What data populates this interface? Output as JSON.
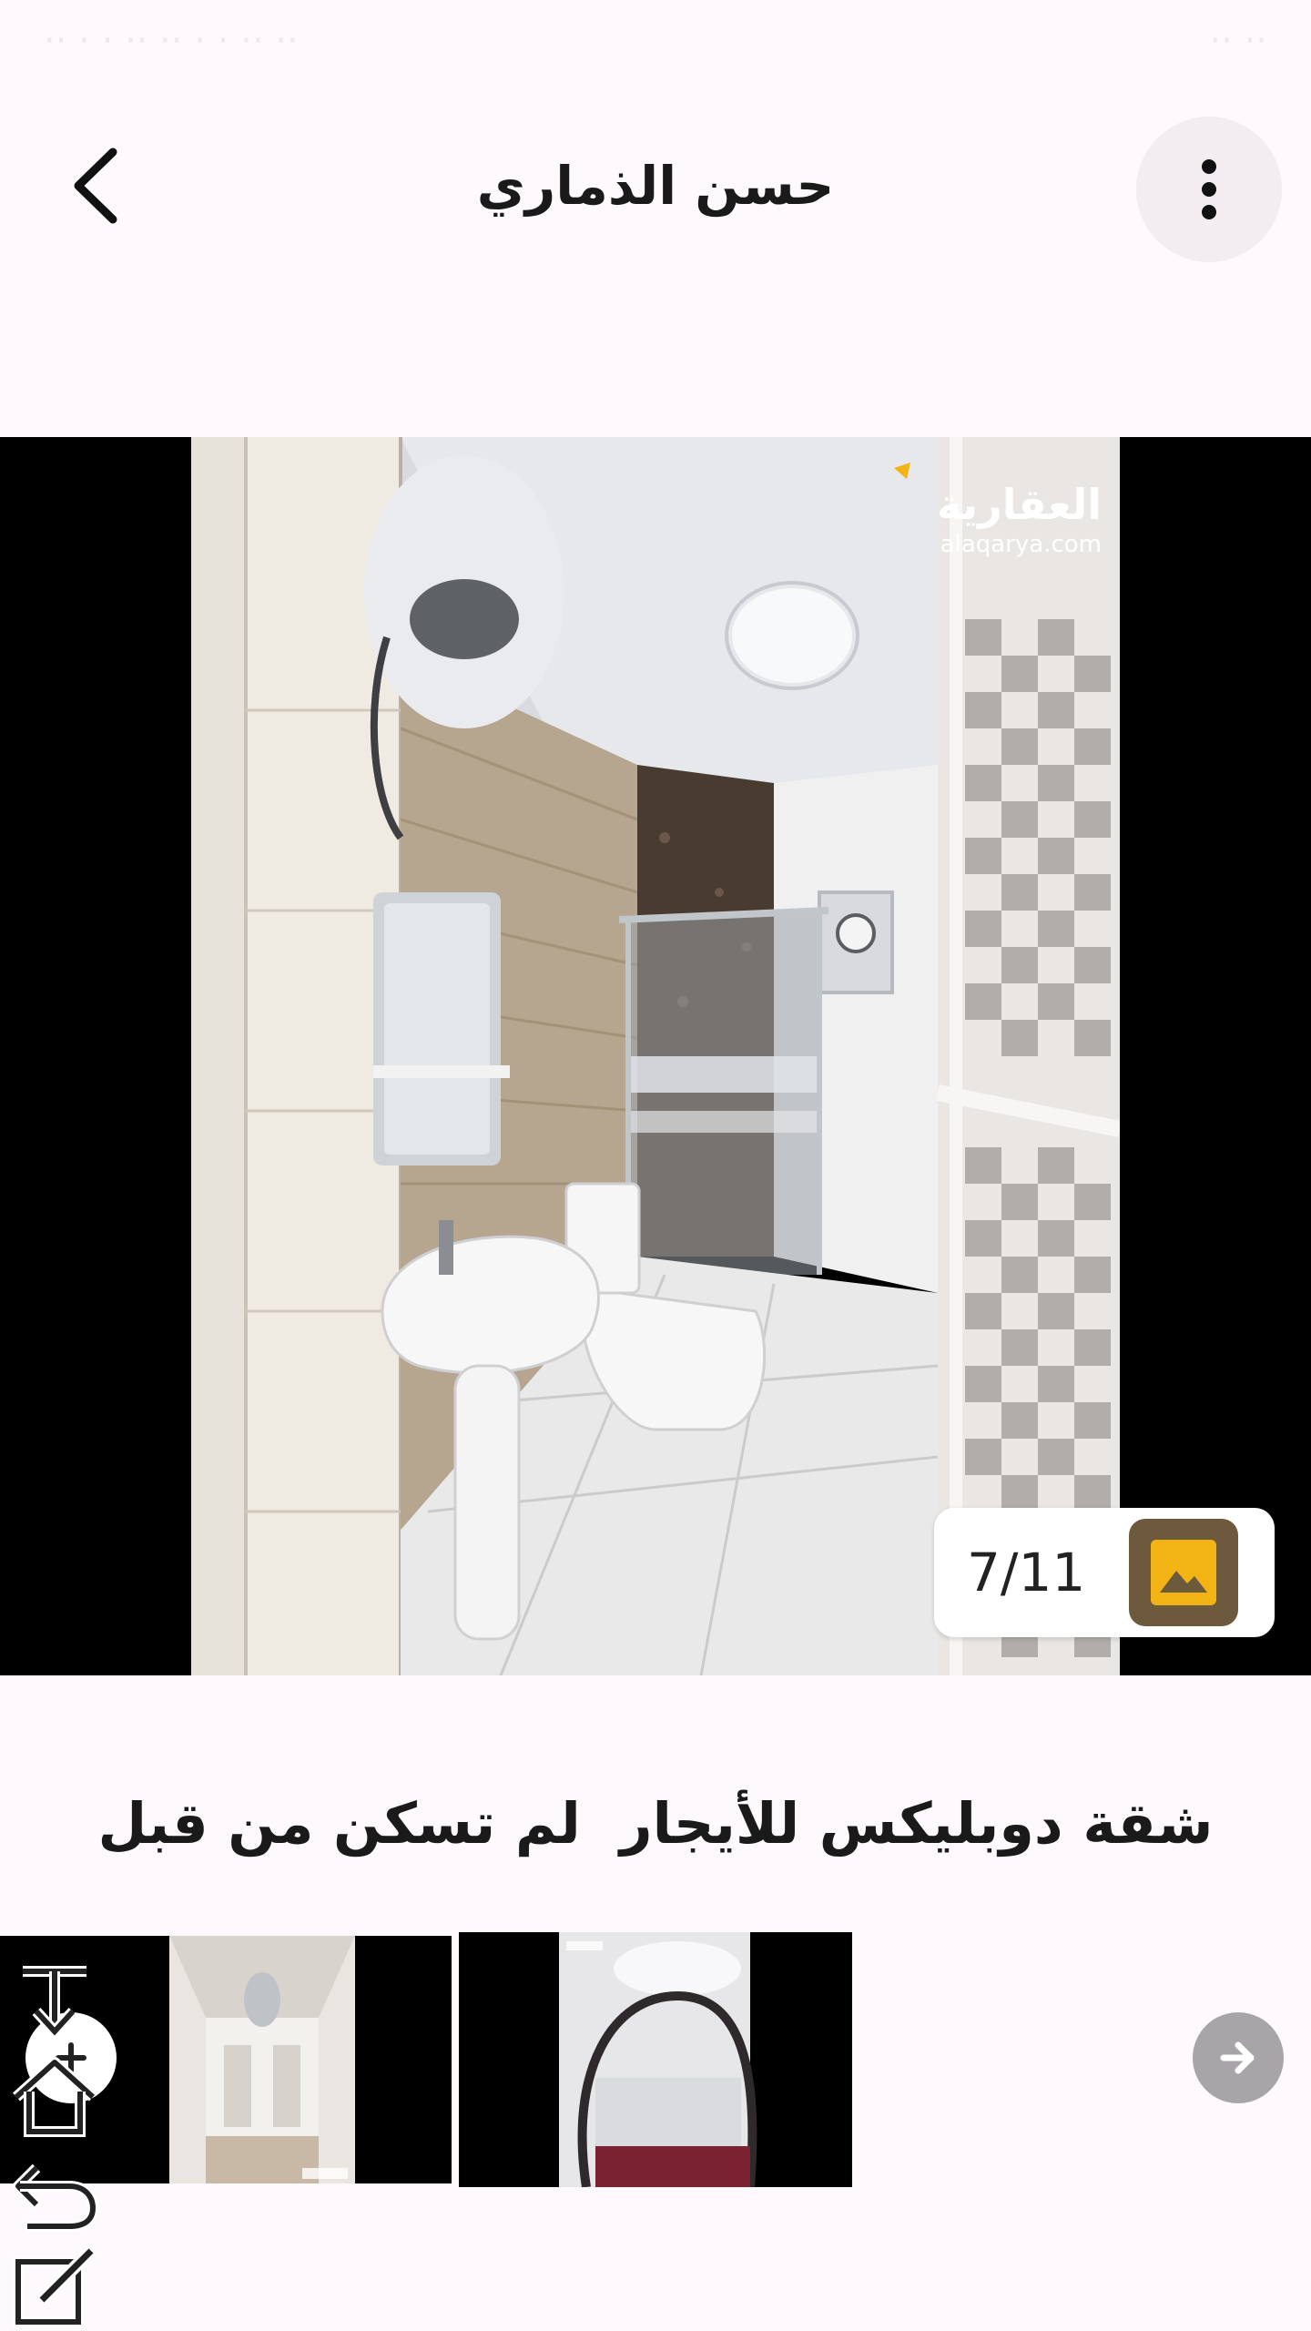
{
  "status_bar": {
    "left_text": "·· · · ·· ·· · · ·· ··",
    "right_text": "·· ··"
  },
  "header": {
    "title": "حسن الذماري",
    "back_icon": "chevron-left-icon",
    "menu_icon": "more-vertical-icon"
  },
  "gallery": {
    "counter": "7/11",
    "counter_icon": "image-icon",
    "watermark_brand": "العقارية",
    "watermark_url": "alaqarya.com",
    "accent_color": "#6d5a3c",
    "icon_color": "#f2b315"
  },
  "listing": {
    "title": "شقة دوبليكس للأيجار  لم تسكن من قبل"
  },
  "thumbnails": {
    "items": [
      {
        "name": "thumbnail-1"
      },
      {
        "name": "thumbnail-2"
      }
    ],
    "next_icon": "arrow-right-icon",
    "prev_icon": "plus-icon"
  },
  "side_tools": {
    "items": [
      "download-icon",
      "home-icon",
      "undo-icon",
      "edit-icon"
    ]
  }
}
